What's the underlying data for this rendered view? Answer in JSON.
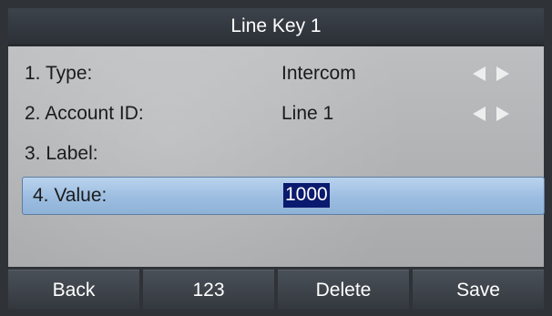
{
  "window": {
    "title": "Line Key 1"
  },
  "fields": [
    {
      "label": "1. Type:",
      "value": "Intercom",
      "has_arrows": true
    },
    {
      "label": "2. Account ID:",
      "value": "Line 1",
      "has_arrows": true
    },
    {
      "label": "3. Label:",
      "value": "",
      "has_arrows": false
    },
    {
      "label": "4. Value:",
      "value": "1000",
      "selected": true
    }
  ],
  "softkeys": [
    {
      "label": "Back"
    },
    {
      "label": "123"
    },
    {
      "label": "Delete"
    },
    {
      "label": "Save"
    }
  ],
  "icons": {
    "left_arrow": "left-arrow-icon",
    "right_arrow": "right-arrow-icon"
  },
  "colors": {
    "title_bar": "#2f3338",
    "content_bg": "#b5b7b9",
    "selected_row": "#9cbde0",
    "value_highlight": "#0a1a6e",
    "softkey_bg": "#3a3f45"
  }
}
